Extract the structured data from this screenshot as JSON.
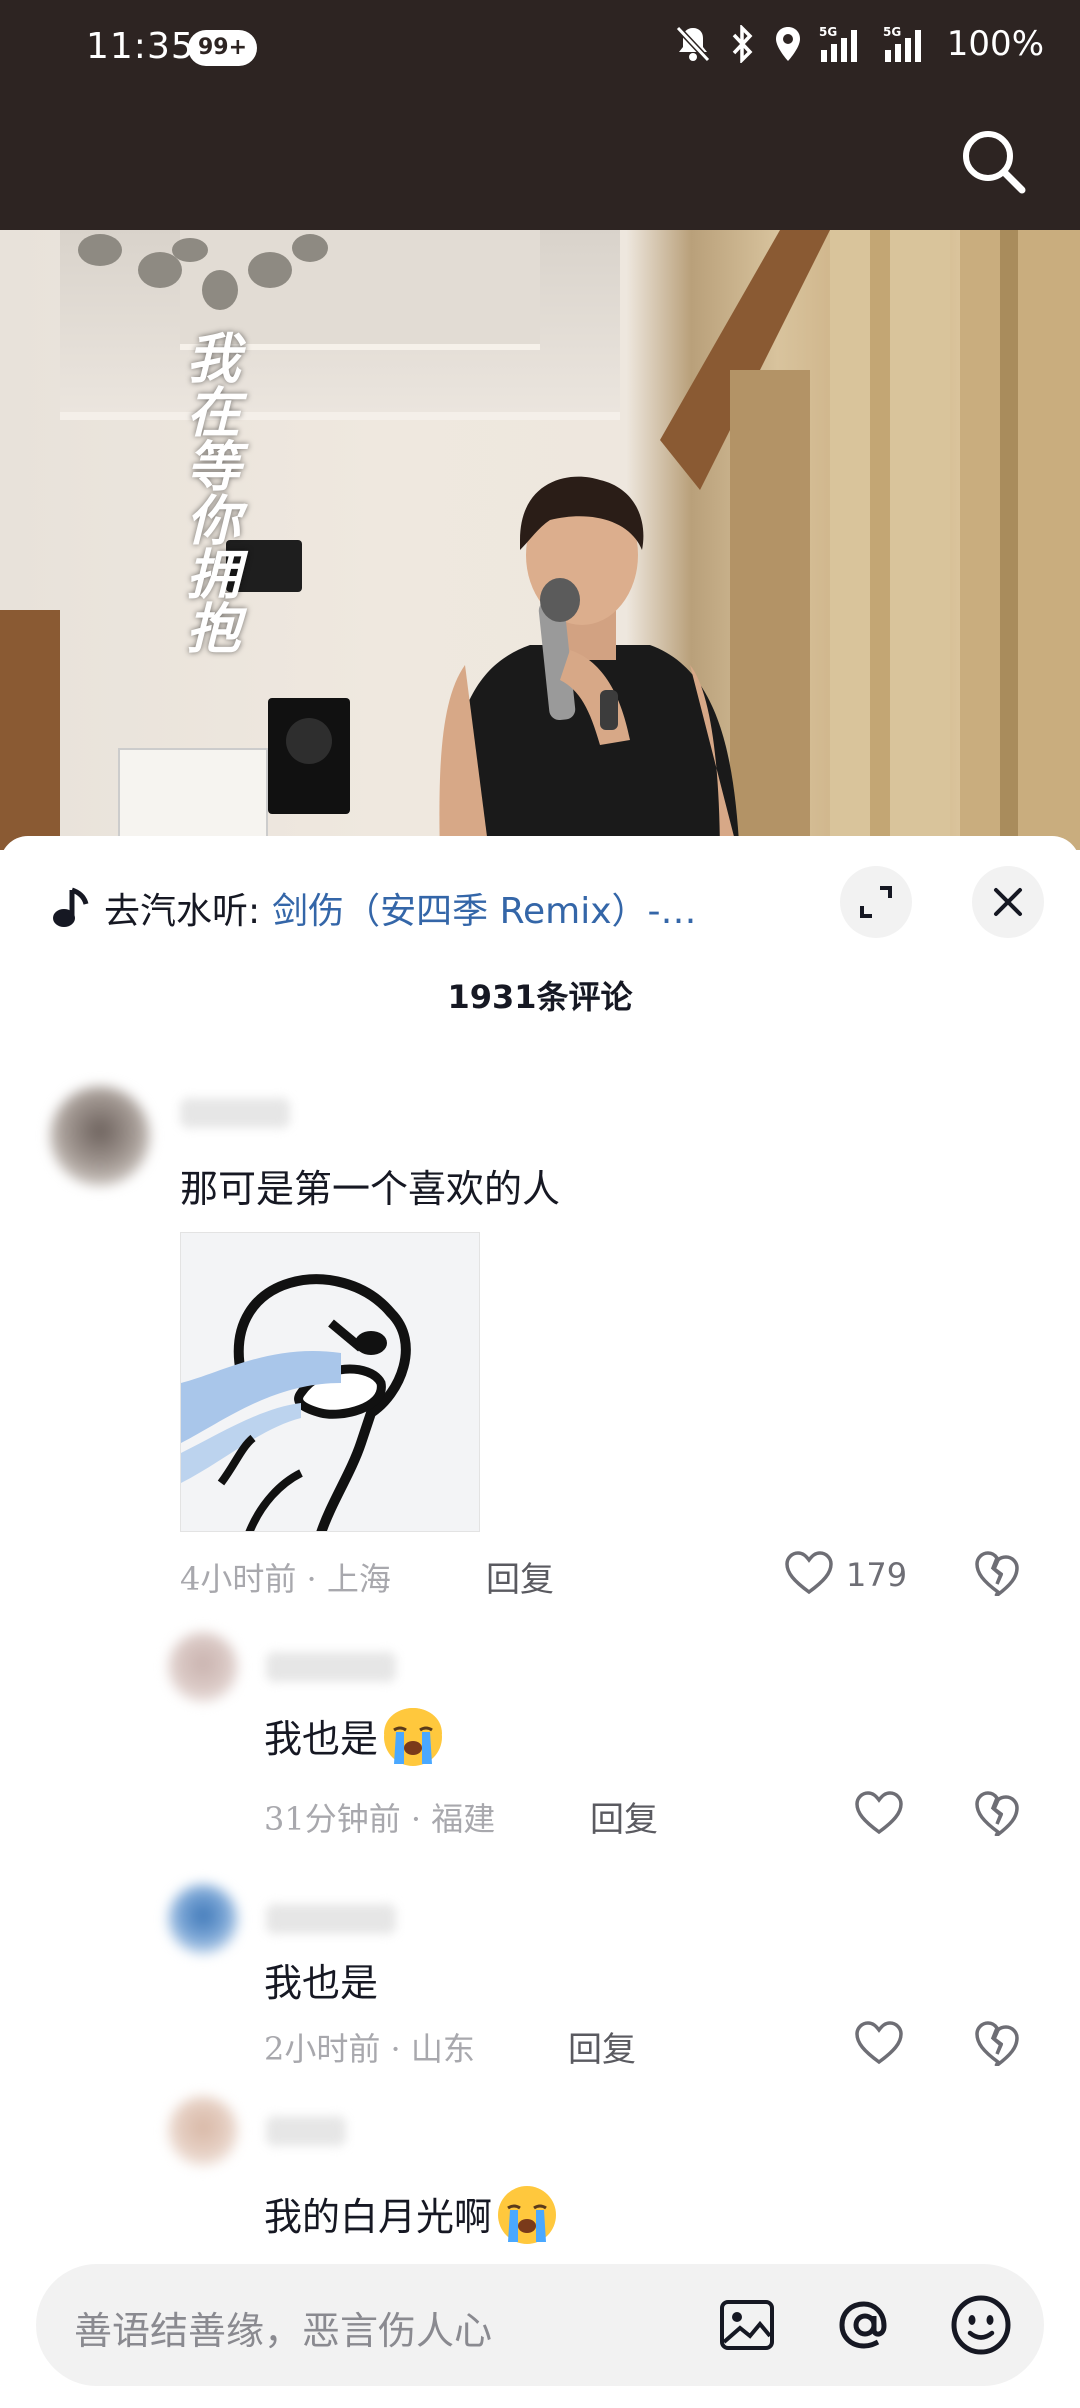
{
  "status_bar": {
    "time": "11:35",
    "badge": "99+",
    "battery": "100%",
    "network": "5G"
  },
  "video": {
    "caption": "我在等你拥抱"
  },
  "music": {
    "prefix": "去汽水听:",
    "title": "剑伤（安四季 Remix）-…"
  },
  "comment_count": "1931条评论",
  "comments": [
    {
      "text": "那可是第一个喜欢的人",
      "time_location": "4小时前 · 上海",
      "reply": "回复",
      "likes": "179"
    },
    {
      "text": "我也是",
      "emoji": "loudly-crying-face",
      "time_location": "31分钟前 · 福建",
      "reply": "回复"
    },
    {
      "text": "我也是",
      "time_location": "2小时前 · 山东",
      "reply": "回复"
    },
    {
      "text": "我的白月光啊",
      "emoji": "loudly-crying-face"
    }
  ],
  "input": {
    "placeholder": "善语结善缘，恶言伤人心"
  },
  "colors": {
    "link": "#3466a8",
    "topbar": "#2d2422",
    "meta": "#a8a8ad"
  }
}
